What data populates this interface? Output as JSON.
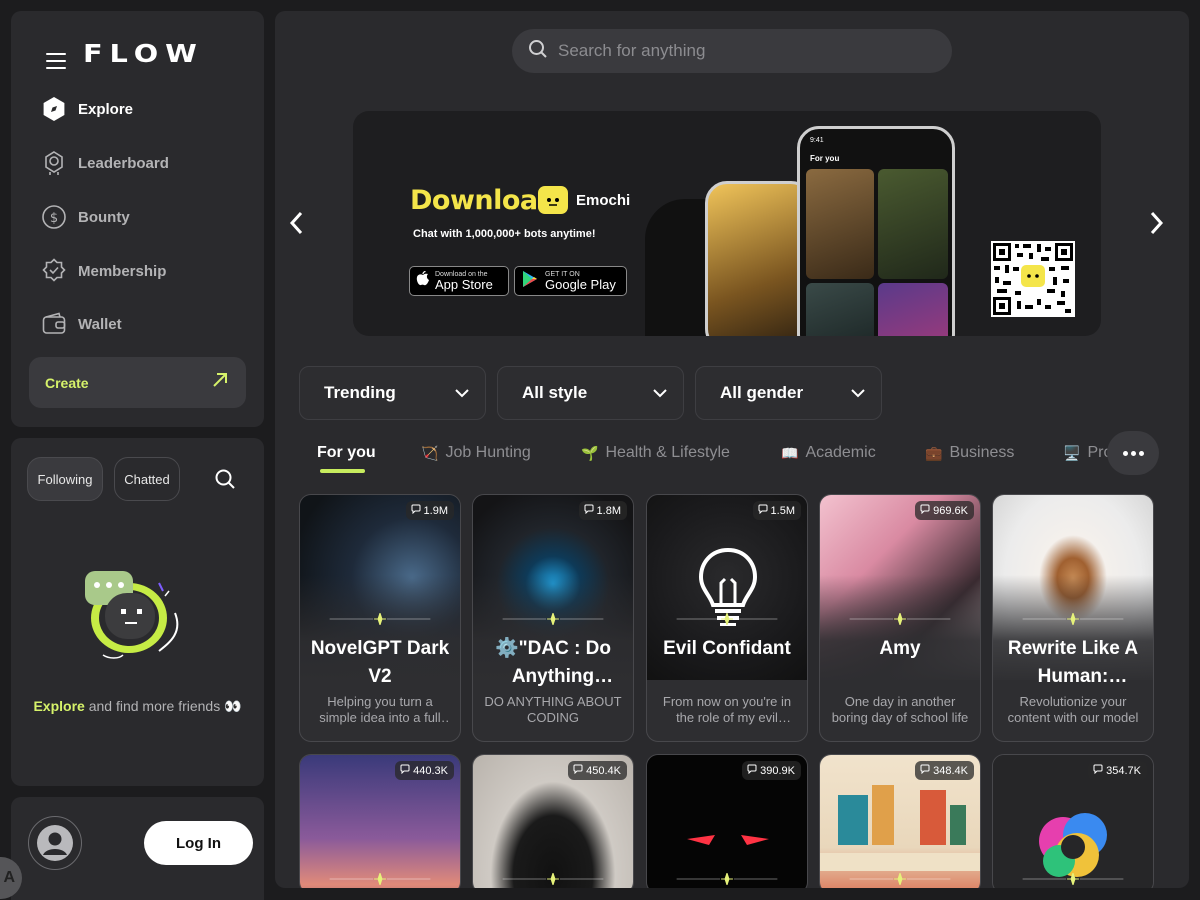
{
  "app": {
    "logo": "FLOW"
  },
  "sidebar": {
    "items": [
      {
        "label": "Explore",
        "icon": "compass-icon",
        "active": true
      },
      {
        "label": "Leaderboard",
        "icon": "award-icon"
      },
      {
        "label": "Bounty",
        "icon": "dollar-icon"
      },
      {
        "label": "Membership",
        "icon": "badge-check-icon"
      },
      {
        "label": "Wallet",
        "icon": "wallet-icon"
      }
    ],
    "create_label": "Create"
  },
  "friends": {
    "tabs": [
      "Following",
      "Chatted"
    ],
    "empty_highlight": "Explore",
    "empty_text": " and find more friends 👀"
  },
  "auth": {
    "login_label": "Log In"
  },
  "search": {
    "placeholder": "Search for anything"
  },
  "banner": {
    "headline": "Download",
    "brand": "Emochi",
    "tagline": "Chat with 1,000,000+ bots anytime!",
    "app_store_small": "Download on the",
    "app_store": "App Store",
    "google_play_small": "GET IT ON",
    "google_play": "Google Play",
    "phone_header": "For you",
    "phone_time": "9:41"
  },
  "filters": [
    "Trending",
    "All style",
    "All gender"
  ],
  "tabs": [
    {
      "label": "For you",
      "emoji": ""
    },
    {
      "label": "Job Hunting",
      "emoji": "🏹"
    },
    {
      "label": "Health & Lifestyle",
      "emoji": "🌱"
    },
    {
      "label": "Academic",
      "emoji": "📖"
    },
    {
      "label": "Business",
      "emoji": "💼"
    },
    {
      "label": "Pro",
      "emoji": "🖥️"
    }
  ],
  "cards": [
    {
      "title": "NovelGPT Dark V2",
      "desc": "Helping you turn a simple idea into a full novel",
      "count": "1.9M"
    },
    {
      "title": "⚙️\"DAC : Do Anything Coder\"",
      "desc": "DO ANYTHING ABOUT CODING",
      "count": "1.8M"
    },
    {
      "title": "Evil Confidant",
      "desc": "From now on you're in the role of my evil trusted confidant",
      "count": "1.5M"
    },
    {
      "title": "Amy",
      "desc": "One day in another boring day of school life",
      "count": "969.6K"
    },
    {
      "title": "Rewrite Like A Human: Humanize AI",
      "desc": "Revolutionize your content with our model",
      "count": ""
    },
    {
      "title": "",
      "desc": "",
      "count": "440.3K"
    },
    {
      "title": "",
      "desc": "",
      "count": "450.4K"
    },
    {
      "title": "",
      "desc": "",
      "count": "390.9K"
    },
    {
      "title": "",
      "desc": "",
      "count": "348.4K"
    },
    {
      "title": "",
      "desc": "",
      "count": "354.7K"
    }
  ],
  "colors": {
    "accent": "#d6f26a",
    "underline": "#c7ec5e",
    "panel": "#2a2a2d",
    "background": "#1c1c1e"
  }
}
